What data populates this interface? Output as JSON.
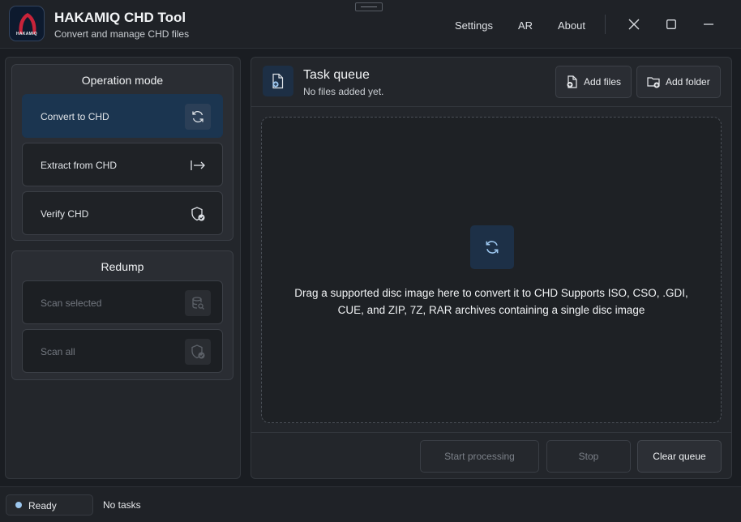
{
  "app": {
    "title": "HAKAMIQ CHD Tool",
    "subtitle": "Convert and manage CHD files",
    "logo_text": "HAKAMIQ"
  },
  "menu": {
    "settings": "Settings",
    "language": "AR",
    "about": "About"
  },
  "operation_mode": {
    "title": "Operation mode",
    "items": [
      {
        "label": "Convert to CHD",
        "icon": "refresh-icon",
        "state": "active"
      },
      {
        "label": "Extract from CHD",
        "icon": "arrow-right-bar-icon",
        "state": "normal"
      },
      {
        "label": "Verify CHD",
        "icon": "shield-check-icon",
        "state": "normal"
      }
    ]
  },
  "redump": {
    "title": "Redump",
    "items": [
      {
        "label": "Scan selected",
        "icon": "database-search-icon",
        "state": "disabled"
      },
      {
        "label": "Scan all",
        "icon": "shield-check-icon",
        "state": "disabled"
      }
    ]
  },
  "task_queue": {
    "title": "Task queue",
    "subtitle": "No files added yet.",
    "add_files": "Add files",
    "add_folder": "Add folder",
    "drop_text": "Drag a supported disc image here to convert it to CHD Supports ISO, CSO, .GDI, CUE, and ZIP, 7Z, RAR archives containing a single disc image",
    "start": "Start processing",
    "stop": "Stop",
    "clear": "Clear queue"
  },
  "status": {
    "state": "Ready",
    "tasks": "No tasks"
  },
  "colors": {
    "accent": "#1b3550",
    "status_dot": "#9cc6ee",
    "background": "#1a1d22"
  }
}
